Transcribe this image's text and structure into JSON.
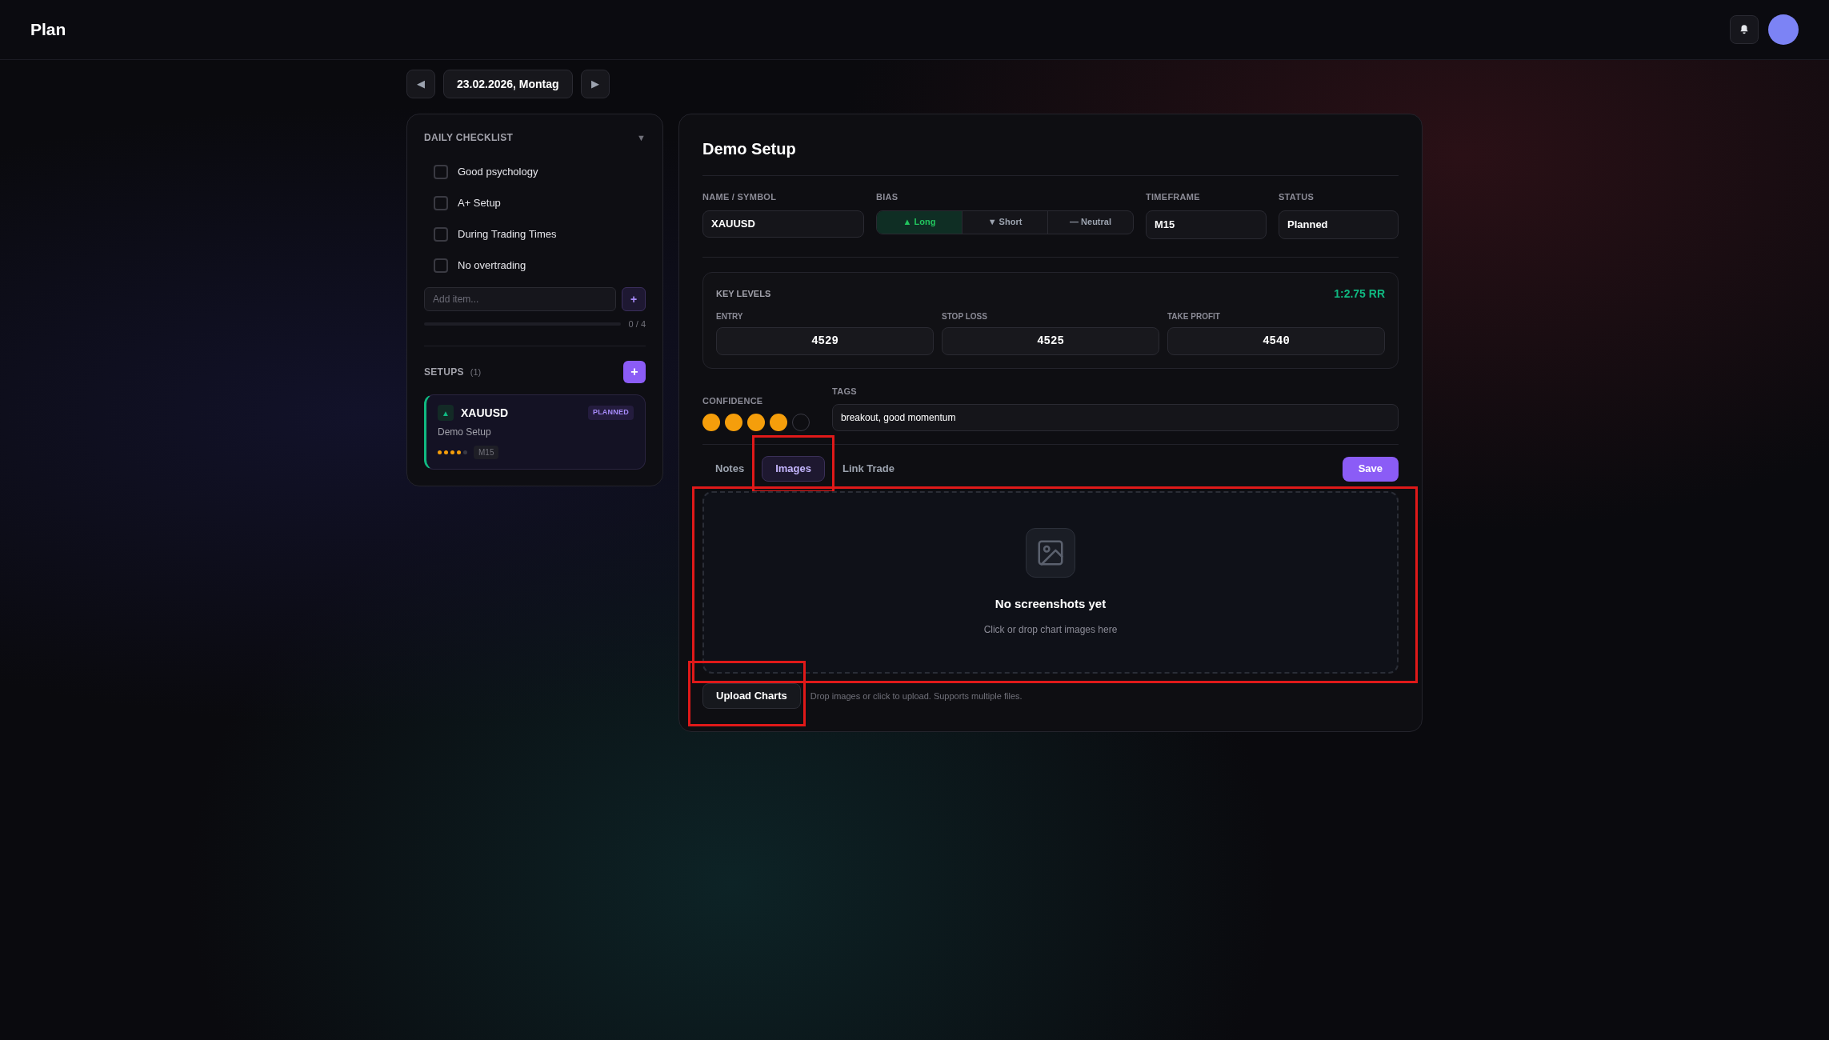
{
  "header": {
    "title": "Plan"
  },
  "date_nav": {
    "prev": "◀",
    "date": "23.02.2026, Montag",
    "next": "▶"
  },
  "checklist": {
    "title": "DAILY CHECKLIST",
    "toggle": "▼",
    "expanded": true,
    "items": [
      {
        "label": "Good psychology",
        "checked": false
      },
      {
        "label": "A+ Setup",
        "checked": false
      },
      {
        "label": "During Trading Times",
        "checked": false
      },
      {
        "label": "No overtrading",
        "checked": false
      }
    ],
    "add_placeholder": "Add item...",
    "add_button": "+",
    "level": 0,
    "progress": "0 / 4"
  },
  "setups": {
    "title": "SETUPS",
    "count": "(1)",
    "add_button": "+",
    "items": [
      {
        "kind": "long",
        "marker": "▲",
        "symbol": "XAUUSD",
        "status": "PLANNED",
        "name": "Demo Setup",
        "stars": 4,
        "timeframe": "M15",
        "selected": true
      }
    ]
  },
  "editor": {
    "title": "Demo Setup",
    "name_label": "NAME / SYMBOL",
    "name_value": "XAUUSD",
    "bias_label": "BIAS",
    "bias": [
      {
        "label": "▲ Long",
        "selected": true
      },
      {
        "label": "▼ Short",
        "selected": false
      },
      {
        "label": "— Neutral",
        "selected": false
      }
    ],
    "timeframe_label": "TIMEFRAME",
    "timeframe_value": "M15",
    "status_label": "STATUS",
    "status_value": "Planned",
    "key_levels": {
      "title": "KEY LEVELS",
      "rr": "1:2.75 RR",
      "fields": [
        {
          "label": "ENTRY",
          "value": "4529"
        },
        {
          "label": "STOP LOSS",
          "value": "4525"
        },
        {
          "label": "TAKE PROFIT",
          "value": "4540"
        }
      ]
    },
    "confidence_label": "CONFIDENCE",
    "confidence": {
      "stars": 4
    },
    "tags_label": "TAGS",
    "tags_value": "breakout, good momentum",
    "tabs": [
      {
        "label": "Notes",
        "selected": false,
        "highlighted": false
      },
      {
        "label": "Images",
        "selected": true,
        "highlighted": true
      },
      {
        "label": "Link Trade",
        "selected": false,
        "highlighted": false
      }
    ],
    "save": "Save",
    "dropzone": {
      "title": "No screenshots yet",
      "hint": "Click or drop chart images here",
      "highlighted": true
    },
    "upload_button": {
      "label": "Upload Charts",
      "highlighted": true
    },
    "upload_hint": "Drop images or click to upload. Supports multiple files."
  }
}
